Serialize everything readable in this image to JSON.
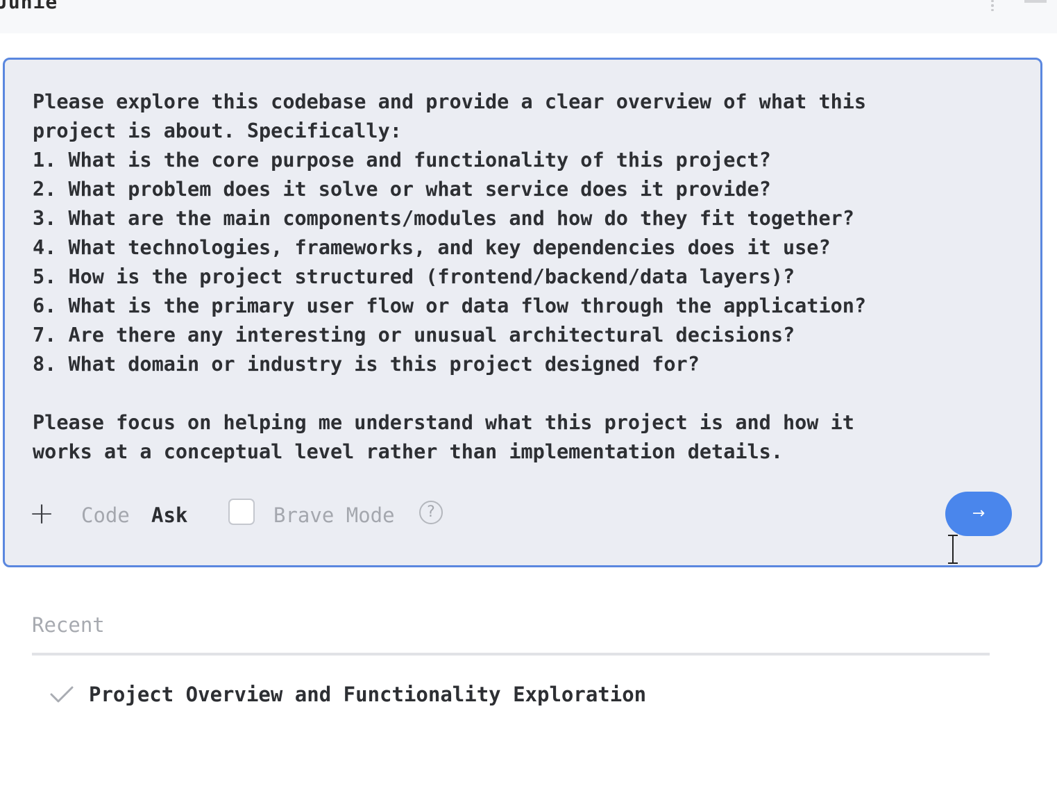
{
  "window": {
    "title": "Junie"
  },
  "prompt": {
    "text": "Please explore this codebase and provide a clear overview of what this\nproject is about. Specifically:\n1. What is the core purpose and functionality of this project?\n2. What problem does it solve or what service does it provide?\n3. What are the main components/modules and how do they fit together?\n4. What technologies, frameworks, and key dependencies does it use?\n5. How is the project structured (frontend/backend/data layers)?\n6. What is the primary user flow or data flow through the application?\n7. Are there any interesting or unusual architectural decisions?\n8. What domain or industry is this project designed for?\n\nPlease focus on helping me understand what this project is and how it\nworks at a conceptual level rather than implementation details."
  },
  "toolbar": {
    "add_icon": "plus-icon",
    "add_label": "+",
    "mode_code": "Code",
    "mode_ask": "Ask",
    "selected_mode": "Ask",
    "brave_mode_label": "Brave Mode",
    "brave_mode_checked": false,
    "help_icon": "question-circle-icon",
    "help_label": "?",
    "send_icon": "arrow-right-icon",
    "send_label": "→",
    "accent_color": "#4a86ec"
  },
  "recent": {
    "heading": "Recent",
    "items": [
      {
        "status_icon": "check-icon",
        "label": "Project Overview and Functionality Exploration"
      }
    ]
  }
}
